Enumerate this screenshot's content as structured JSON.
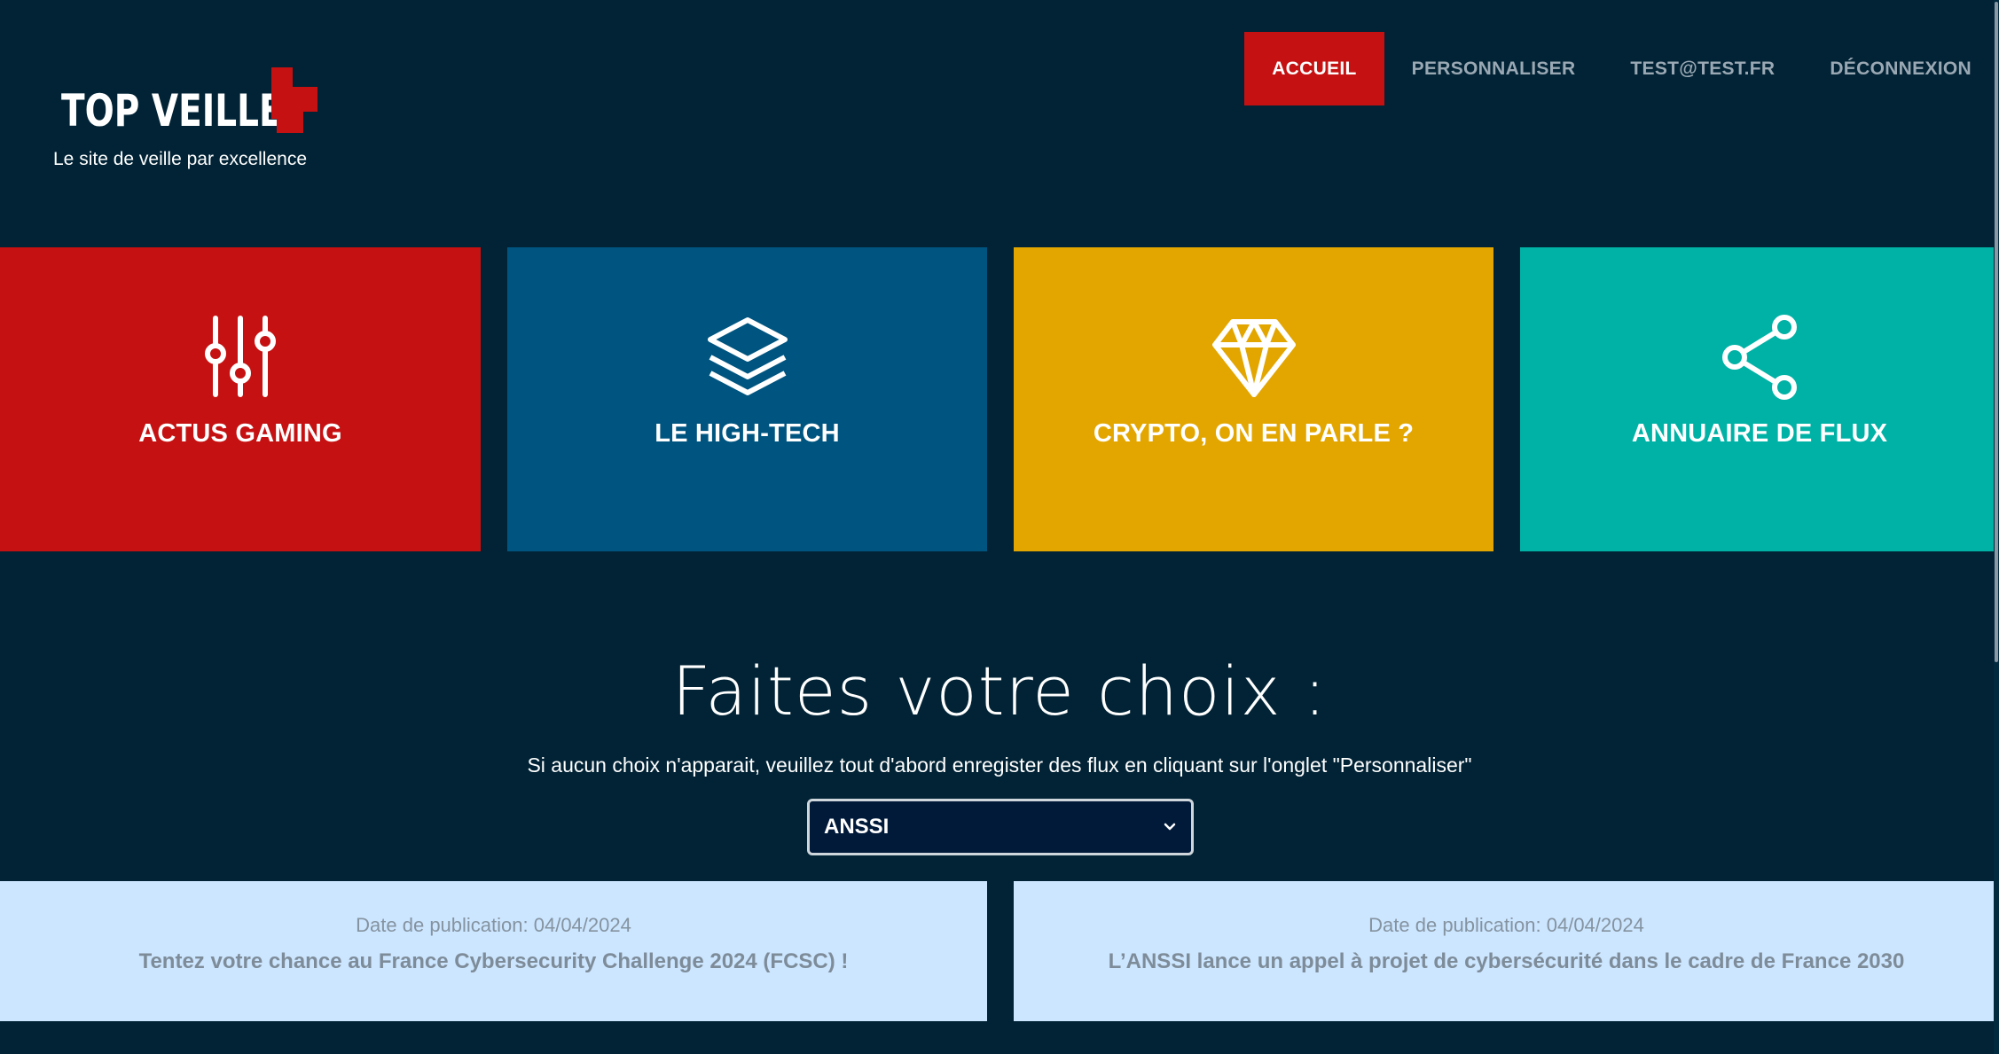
{
  "brand": {
    "logo_text": "TOP VEILLE",
    "tagline": "Le site de veille par excellence"
  },
  "nav": {
    "items": [
      {
        "label": "ACCUEIL",
        "active": true
      },
      {
        "label": "PERSONNALISER",
        "active": false
      },
      {
        "label": "TEST@TEST.FR",
        "active": false
      },
      {
        "label": "DÉCONNEXION",
        "active": false
      }
    ]
  },
  "tiles": [
    {
      "label": "ACTUS GAMING",
      "icon": "sliders-icon",
      "color": "#c51111"
    },
    {
      "label": "LE HIGH-TECH",
      "icon": "layers-icon",
      "color": "#005580"
    },
    {
      "label": "CRYPTO, ON EN PARLE ?",
      "icon": "diamond-icon",
      "color": "#e3a600"
    },
    {
      "label": "ANNUAIRE DE FLUX",
      "icon": "share-icon",
      "color": "#00b2a6"
    }
  ],
  "choice": {
    "heading": "Faites votre choix :",
    "note": "Si aucun choix n'apparait, veuillez tout d'abord enregister des flux en cliquant sur l'onglet \"Personnaliser\"",
    "select_value": "ANSSI"
  },
  "articles": [
    {
      "date": "Date de publication: 04/04/2024",
      "title": "Tentez votre chance au France Cybersecurity Challenge 2024 (FCSC) !"
    },
    {
      "date": "Date de publication: 04/04/2024",
      "title": "L’ANSSI lance un appel à projet de cybersécurité dans le cadre de France 2030"
    }
  ],
  "colors": {
    "background": "#012335",
    "accent": "#c51111",
    "article_bg": "#cce6ff"
  }
}
